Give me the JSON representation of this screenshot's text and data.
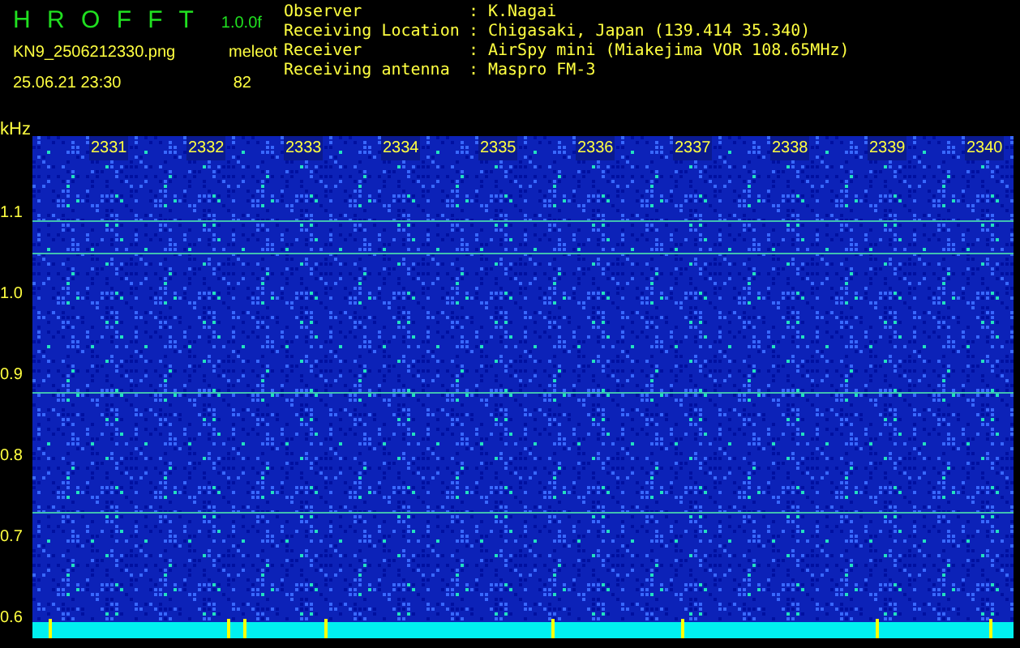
{
  "header": {
    "title": "H R O F F T",
    "version": "1.0.0f",
    "filename": "KN9_2506212330.png",
    "timestamp": "25.06.21 23:30",
    "counter_label": "meleot",
    "counter_value": "82"
  },
  "info": [
    {
      "label": "Observer",
      "separator": ":",
      "value": "K.Nagai"
    },
    {
      "label": "Receiving Location",
      "separator": ":",
      "value": "Chigasaki, Japan (139.414 35.340)"
    },
    {
      "label": "Receiver",
      "separator": ":",
      "value": "AirSpy mini (Miakejima VOR 108.65MHz)"
    },
    {
      "label": "Receiving antenna",
      "separator": ":",
      "value": "Maspro FM-3"
    }
  ],
  "plot": {
    "y_unit": "kHz",
    "y_labels": [
      "1.1",
      "1.0",
      "0.9",
      "0.8",
      "0.7",
      "0.6"
    ],
    "x_labels": [
      "2331",
      "2332",
      "2333",
      "2334",
      "2335",
      "2336",
      "2337",
      "2338",
      "2339",
      "2340"
    ]
  }
}
